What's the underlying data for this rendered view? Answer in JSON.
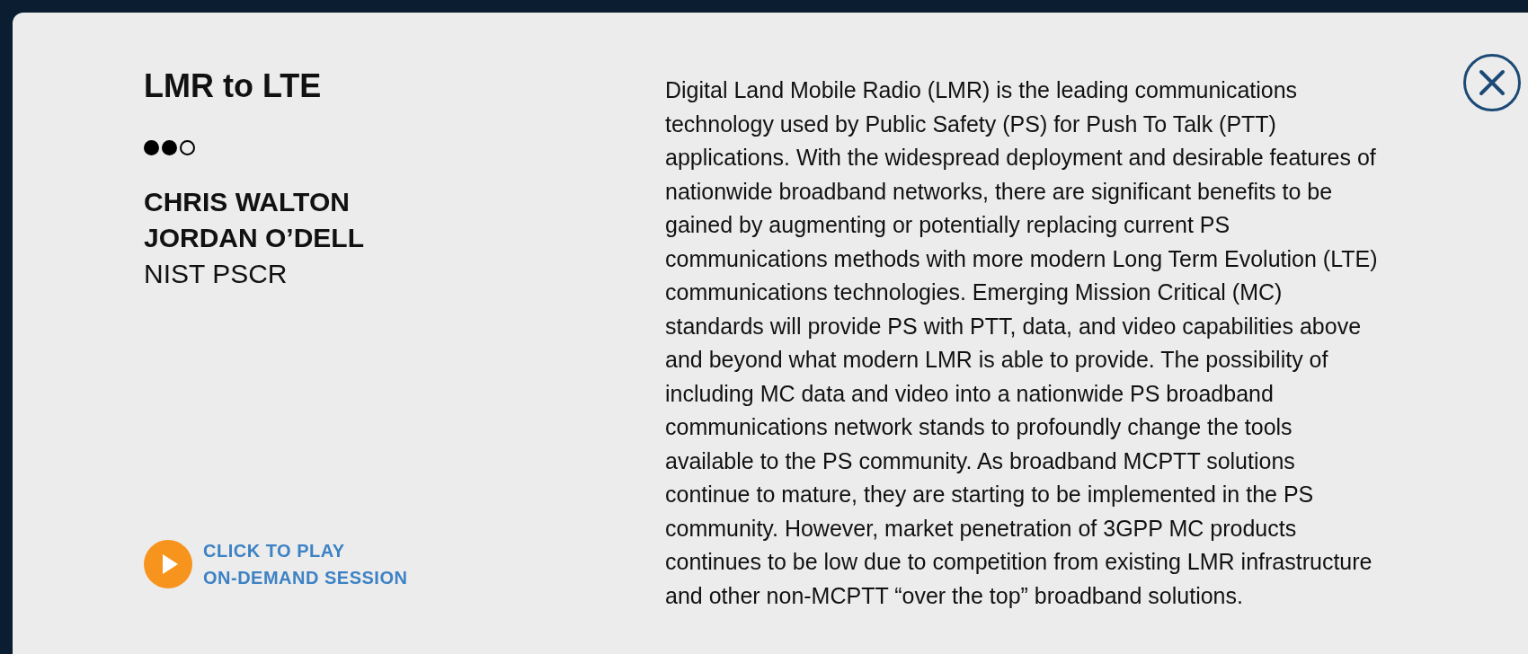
{
  "session": {
    "title": "LMR to LTE",
    "stars": 2,
    "speakers": [
      "CHRIS WALTON",
      "JORDAN O’DELL"
    ],
    "organization": "NIST PSCR",
    "play_link": [
      "CLICK TO PLAY",
      "ON-DEMAND SESSION"
    ],
    "description": "Digital Land Mobile Radio (LMR) is the leading communications technology used by Public Safety (PS) for Push To Talk (PTT) applications. With the widespread deployment and desirable features of nationwide broadband networks, there are significant benefits to be gained by augmenting or potentially replacing current PS communications methods with more modern Long Term Evolution (LTE) communications technologies. Emerging Mission Critical (MC) standards will provide PS with PTT, data, and video capabilities above and beyond what modern LMR is able to provide. The possibility of including MC data and video into a nationwide PS broadband communications network stands to profoundly change the tools available to the PS community. As broadband MCPTT solutions continue to mature, they are starting to be implemented in the PS community. However, market penetration of 3GPP MC products continues to be low due to competition from existing LMR infrastructure and other non-MCPTT “over the top” broadband solutions."
  }
}
